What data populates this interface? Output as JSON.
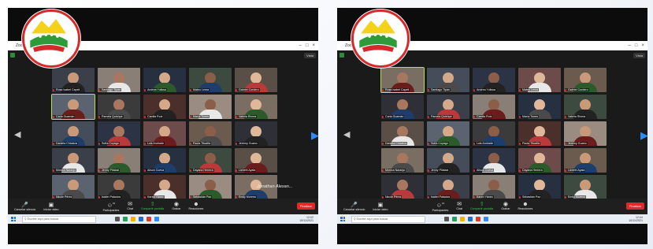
{
  "colors": {
    "zoom_dark": "#1a1a1a",
    "toolbar": "#1f1f1f",
    "end_button": "#e02828",
    "active_speaker": "#b8e04a",
    "logo_ring": "#d42a2a",
    "logo_yellow": "#f5d21a",
    "logo_green": "#2f9a3a"
  },
  "panels": [
    {
      "window_title": "Zoom",
      "view_label": "Vista",
      "names": [
        "Rosa Isabel Capeli",
        "Santiago Tipán",
        "Andrea Yulissa",
        "Mateo Lema",
        "Gabriel Cordero",
        "Carla Guamán",
        "Pamela Quishpe",
        "Camila Ruiz",
        "María Torres",
        "Valeria Rivera",
        "Daniela Chicaiza",
        "Sofía Coyago",
        "Luis Andrade",
        "Paola Tituaña",
        "Jeremy Guano",
        "Mónica Naranjo",
        "Jenny Pilataxi",
        "Alison Cueva",
        "Dayana Herrera",
        "Lizbeth Ayala",
        "Nicole Pérez",
        "Isabel Palacios",
        "Karen Yánez",
        "Sebastián Paz",
        "Emily Moreno"
      ],
      "overlay": "Jonathan Alexan...",
      "toolbar_left": [
        "Cancelar silencio",
        "Iniciar video"
      ],
      "toolbar_center": [
        "Participantes",
        "Chat",
        "Compartir pantalla",
        "Grabar",
        "Reacciones"
      ],
      "participant_count": "31",
      "end_label": "Finalizar",
      "search_placeholder": "Escribe aquí para buscar",
      "clock": "12:02",
      "date": "10/11/2021"
    },
    {
      "window_title": "Zoom",
      "view_label": "Vista",
      "names": [
        "Rosa Isabel Capeli",
        "Santiago Tipán",
        "Andrea Yulissa",
        "Mateo Lema",
        "Gabriel Cordero",
        "Carla Guamán",
        "Pamela Quishpe",
        "Camila Ruiz",
        "María Torres",
        "Valeria Rivera",
        "Daniela Chicaiza",
        "Sofía Coyago",
        "Luis Andrade",
        "Paola Tituaña",
        "Jeremy Guano",
        "Mónica Naranjo",
        "Jenny Pilataxi",
        "Alison Cueva",
        "Dayana Herrera",
        "Lizbeth Ayala",
        "Nicole Pérez",
        "Isabel Palacios",
        "Karen Yánez",
        "Sebastián Paz",
        "Emily Moreno"
      ],
      "overlay": "",
      "toolbar_left": [
        "Cancelar silencio",
        "Iniciar video"
      ],
      "toolbar_center": [
        "Participantes",
        "Chat",
        "Compartir pantalla",
        "Grabar",
        "Reacciones"
      ],
      "participant_count": "31",
      "end_label": "Finalizar",
      "search_placeholder": "Escribe aquí para buscar",
      "clock": "12:04",
      "date": "10/11/2021"
    }
  ]
}
